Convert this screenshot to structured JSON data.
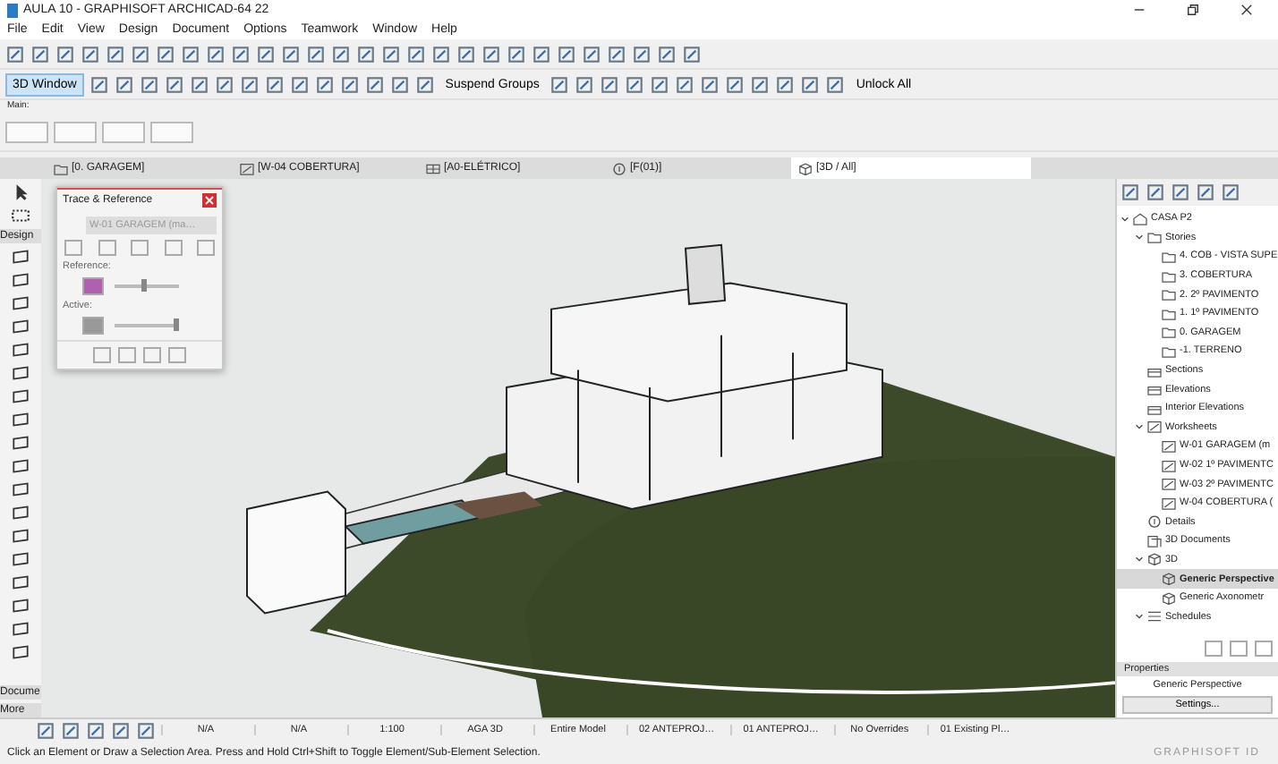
{
  "window": {
    "title": "AULA 10 - GRAPHISOFT ARCHICAD-64 22"
  },
  "menu": [
    "File",
    "Edit",
    "View",
    "Design",
    "Document",
    "Options",
    "Teamwork",
    "Window",
    "Help"
  ],
  "toolbar": {
    "view_button": {
      "label": "3D Window",
      "selected": true
    },
    "suspend_groups": "Suspend Groups",
    "unlock_all": "Unlock All",
    "main_label": "Main:"
  },
  "tabs": [
    {
      "label": "[0. GARAGEM]",
      "kind": "story",
      "selected": false
    },
    {
      "label": "[W-04 COBERTURA]",
      "kind": "worksheet",
      "selected": false
    },
    {
      "label": "[A0-ELÉTRICO]",
      "kind": "layout",
      "selected": false
    },
    {
      "label": "[F(01)]",
      "kind": "detail",
      "selected": false
    },
    {
      "label": "[3D / All]",
      "kind": "view3d",
      "selected": true
    }
  ],
  "toolbox": {
    "sections": [
      "Design",
      "Docume",
      "More"
    ]
  },
  "trace_panel": {
    "title": "Trace & Reference",
    "reference_name": "W-01 GARAGEM (ma…",
    "reference_label": "Reference:",
    "active_label": "Active:",
    "reference_slider": {
      "level": 0.45
    },
    "active_slider": {
      "level": 0.95
    }
  },
  "navigator": {
    "tree": [
      {
        "label": "CASA P2",
        "kind": "project",
        "expanded": true,
        "selected": false,
        "children": [
          {
            "label": "Stories",
            "kind": "folder",
            "expanded": true,
            "selected": false,
            "children": [
              {
                "label": "4. COB - VISTA SUPE",
                "kind": "story",
                "selected": false
              },
              {
                "label": "3. COBERTURA",
                "kind": "story",
                "selected": false
              },
              {
                "label": "2. 2º PAVIMENTO",
                "kind": "story",
                "selected": false
              },
              {
                "label": "1. 1º PAVIMENTO",
                "kind": "story",
                "selected": false
              },
              {
                "label": "0. GARAGEM",
                "kind": "story",
                "selected": false
              },
              {
                "label": "-1. TERRENO",
                "kind": "story",
                "selected": false
              }
            ]
          },
          {
            "label": "Sections",
            "kind": "section",
            "selected": false
          },
          {
            "label": "Elevations",
            "kind": "section",
            "selected": false
          },
          {
            "label": "Interior Elevations",
            "kind": "section",
            "selected": false
          },
          {
            "label": "Worksheets",
            "kind": "worksheet",
            "expanded": true,
            "selected": false,
            "children": [
              {
                "label": "W-01 GARAGEM (m",
                "kind": "worksheet",
                "selected": false
              },
              {
                "label": "W-02 1º PAVIMENTC",
                "kind": "worksheet",
                "selected": false
              },
              {
                "label": "W-03 2º PAVIMENTC",
                "kind": "worksheet",
                "selected": false
              },
              {
                "label": "W-04 COBERTURA (",
                "kind": "worksheet",
                "selected": false
              }
            ]
          },
          {
            "label": "Details",
            "kind": "detail",
            "selected": false
          },
          {
            "label": "3D Documents",
            "kind": "doc3d",
            "selected": false
          },
          {
            "label": "3D",
            "kind": "view3d",
            "expanded": true,
            "selected": false,
            "children": [
              {
                "label": "Generic Perspective",
                "kind": "view3d",
                "selected": true
              },
              {
                "label": "Generic Axonometr",
                "kind": "view3d",
                "selected": false
              }
            ]
          },
          {
            "label": "Schedules",
            "kind": "schedule",
            "expanded": true,
            "selected": false
          }
        ]
      }
    ],
    "properties_title": "Properties",
    "properties_value": "Generic Perspective",
    "settings_button": "Settings..."
  },
  "bottom_bar": [
    "N/A",
    "N/A",
    "1:100",
    "AGA 3D",
    "Entire Model",
    "02 ANTEPROJ…",
    "01 ANTEPROJ…",
    "No Overrides",
    "01 Existing Pl…"
  ],
  "status_bar": {
    "message": "Click an Element or Draw a Selection Area. Press and Hold Ctrl+Shift to Toggle Element/Sub-Element Selection.",
    "brand": "GRAPHISOFT ID"
  }
}
